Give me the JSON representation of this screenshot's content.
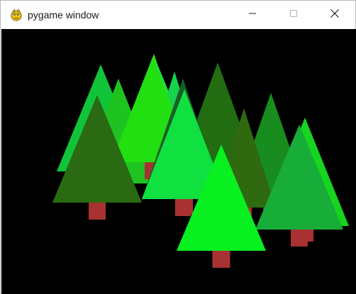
{
  "window": {
    "title": "pygame window",
    "app_icon": "pygame-snake-icon",
    "controls": {
      "minimize_icon": "minimize-icon",
      "maximize_icon": "maximize-icon",
      "close_icon": "close-icon"
    }
  },
  "scene": {
    "background": "#000000",
    "trunk_color": "#a83232",
    "trees": [
      {
        "name": "tree-1",
        "color": "#10c43a"
      },
      {
        "name": "tree-2",
        "color": "#33e01a"
      },
      {
        "name": "tree-3",
        "color": "#20e03a"
      },
      {
        "name": "tree-4",
        "color": "#17d24b"
      },
      {
        "name": "tree-5",
        "color": "#226c11"
      },
      {
        "name": "tree-6",
        "color": "#198c20"
      },
      {
        "name": "tree-7",
        "color": "#2f6a10"
      },
      {
        "name": "tree-8",
        "color": "#1ec321"
      },
      {
        "name": "tree-9",
        "color": "#22df11"
      },
      {
        "name": "tree-10",
        "color": "#1b5f27"
      },
      {
        "name": "tree-11",
        "color": "#16d41f"
      },
      {
        "name": "tree-12",
        "color": "#2a6a12"
      },
      {
        "name": "tree-13",
        "color": "#10e040"
      },
      {
        "name": "tree-14",
        "color": "#17ad38"
      },
      {
        "name": "tree-15",
        "color": "#08f020"
      }
    ]
  }
}
